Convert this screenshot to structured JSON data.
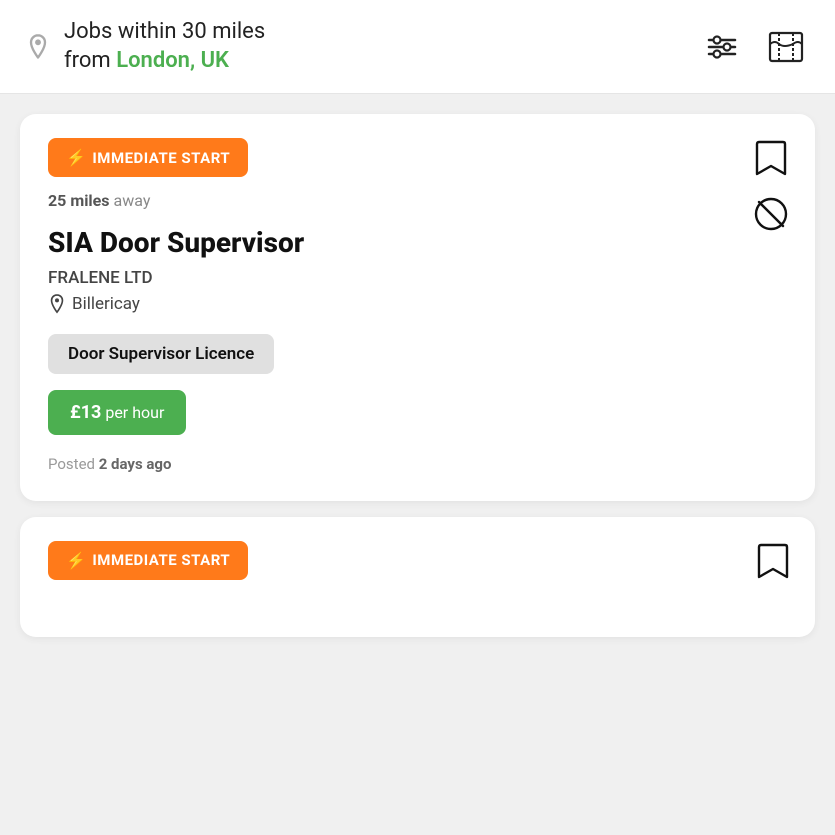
{
  "header": {
    "title_prefix": "Jobs within 30 miles",
    "title_from": "from",
    "city": "London, UK",
    "location_icon": "location-pin-icon",
    "filter_icon": "filter-icon",
    "map_icon": "map-icon"
  },
  "jobs": [
    {
      "badge": "IMMEDIATE START",
      "distance": "25 miles",
      "distance_suffix": " away",
      "title": "SIA Door Supervisor",
      "company": "FRALENE LTD",
      "location": "Billericay",
      "licence": "Door Supervisor Licence",
      "rate": "£13",
      "rate_suffix": " per hour",
      "posted": "Posted ",
      "posted_when": "2 days ago"
    },
    {
      "badge": "IMMEDIATE START"
    }
  ],
  "icons": {
    "bolt": "⚡",
    "bookmark": "bookmark",
    "block": "block",
    "location_pin": "📍"
  }
}
